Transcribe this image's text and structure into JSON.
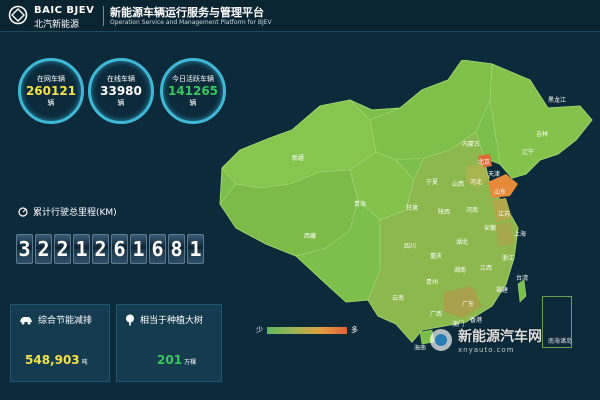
{
  "header": {
    "brand_en": "BAIC BJEV",
    "brand_cn": "北汽新能源",
    "title": "新能源车辆运行服务与管理平台",
    "subtitle": "Operation Service and Management Platform for BJEV"
  },
  "stats": [
    {
      "label": "在网车辆",
      "value": "260121",
      "unit": "辆",
      "color": "#f2e14a"
    },
    {
      "label": "在线车辆",
      "value": "33980",
      "unit": "辆",
      "color": "#ffffff"
    },
    {
      "label": "今日活跃车辆",
      "value": "141265",
      "unit": "辆",
      "color": "#35c85a"
    }
  ],
  "odometer": {
    "label": "累计行驶总里程(KM)",
    "digits": [
      "3",
      "2",
      "2",
      "1",
      "2",
      "6",
      "1",
      "6",
      "8",
      "1"
    ]
  },
  "cards": {
    "emission": {
      "label": "综合节能减排",
      "value": "548,903",
      "unit": "吨"
    },
    "trees": {
      "label": "相当于种植大树",
      "value": "201",
      "unit": "万棵",
      "color": "#35c85a"
    }
  },
  "legend": {
    "low": "少",
    "high": "多"
  },
  "provinces": [
    "新疆",
    "西藏",
    "青海",
    "甘肃",
    "内蒙古",
    "黑龙江",
    "吉林",
    "辽宁",
    "北京",
    "天津",
    "河北",
    "山西",
    "山东",
    "陕西",
    "宁夏",
    "河南",
    "江苏",
    "安徽",
    "上海",
    "四川",
    "重庆",
    "湖北",
    "浙江",
    "贵州",
    "湖南",
    "江西",
    "福建",
    "云南",
    "广西",
    "广东",
    "台湾",
    "海南",
    "澳门",
    "香港"
  ],
  "watermark": {
    "cn": "新能源汽车网",
    "en": "xnyauto.com",
    "south_sea": "南海诸岛"
  }
}
